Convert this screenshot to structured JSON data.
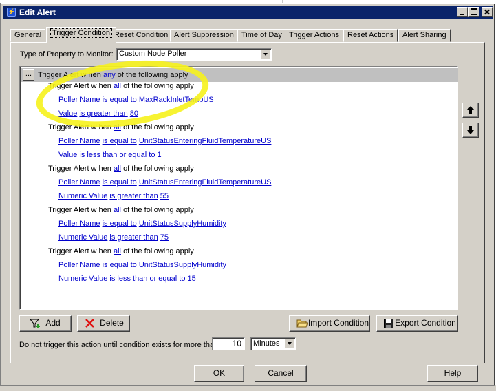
{
  "window": {
    "title": "Edit Alert"
  },
  "tabs": [
    {
      "label": "General",
      "active": false
    },
    {
      "label": "Trigger Condition",
      "active": true
    },
    {
      "label": "Reset Condition",
      "active": false
    },
    {
      "label": "Alert Suppression",
      "active": false
    },
    {
      "label": "Time of Day",
      "active": false
    },
    {
      "label": "Trigger Actions",
      "active": false
    },
    {
      "label": "Reset Actions",
      "active": false
    },
    {
      "label": "Alert Sharing",
      "active": false
    }
  ],
  "property": {
    "label": "Type of Property to Monitor:",
    "value": "Custom Node Poller"
  },
  "tree": {
    "root": {
      "ellipsis": "...",
      "prefix": "Trigger Alert w hen",
      "operator": "any",
      "suffix": "of the following apply"
    },
    "groups": [
      {
        "prefix": "Trigger Alert w hen",
        "operator": "all",
        "suffix": "of the following apply",
        "conditions": [
          {
            "field": "Poller Name",
            "comparison": "is equal to",
            "value": "MaxRackInletTempUS"
          },
          {
            "field": "Value",
            "comparison": "is greater than",
            "value": "80"
          }
        ]
      },
      {
        "prefix": "Trigger Alert w hen",
        "operator": "all",
        "suffix": "of the following apply",
        "conditions": [
          {
            "field": "Poller Name",
            "comparison": "is equal to",
            "value": "UnitStatusEnteringFluidTemperatureUS"
          },
          {
            "field": "Value",
            "comparison": "is less than or equal to",
            "value": "1"
          }
        ]
      },
      {
        "prefix": "Trigger Alert w hen",
        "operator": "all",
        "suffix": "of the following apply",
        "conditions": [
          {
            "field": "Poller Name",
            "comparison": "is equal to",
            "value": "UnitStatusEnteringFluidTemperatureUS"
          },
          {
            "field": "Numeric Value",
            "comparison": "is greater than",
            "value": "55"
          }
        ]
      },
      {
        "prefix": "Trigger Alert w hen",
        "operator": "all",
        "suffix": "of the following apply",
        "conditions": [
          {
            "field": "Poller Name",
            "comparison": "is equal to",
            "value": "UnitStatusSupplyHumidity"
          },
          {
            "field": "Numeric Value",
            "comparison": "is greater than",
            "value": "75"
          }
        ]
      },
      {
        "prefix": "Trigger Alert w hen",
        "operator": "all",
        "suffix": "of the following apply",
        "conditions": [
          {
            "field": "Poller Name",
            "comparison": "is equal to",
            "value": "UnitStatusSupplyHumidity"
          },
          {
            "field": "Numeric Value",
            "comparison": "is less than or equal to",
            "value": "15"
          }
        ]
      }
    ]
  },
  "buttons": {
    "add": "Add",
    "delete": "Delete",
    "import": "Import Condition",
    "export": "Export Condition",
    "ok": "OK",
    "cancel": "Cancel",
    "help": "Help"
  },
  "duration": {
    "label": "Do not trigger this action until condition exists for more than",
    "value": "10",
    "unit": "Minutes"
  },
  "icons": {
    "app": "alert-app-icon",
    "move_up": "arrow-up-icon",
    "move_down": "arrow-down-icon",
    "add": "add-condition-icon",
    "delete": "red-x-icon",
    "import": "folder-open-icon",
    "export": "floppy-disk-icon"
  },
  "colors": {
    "title_bar": "#0a246a",
    "link": "#0000cc",
    "highlight": "#f6f21c",
    "delete_icon": "#e01010"
  }
}
